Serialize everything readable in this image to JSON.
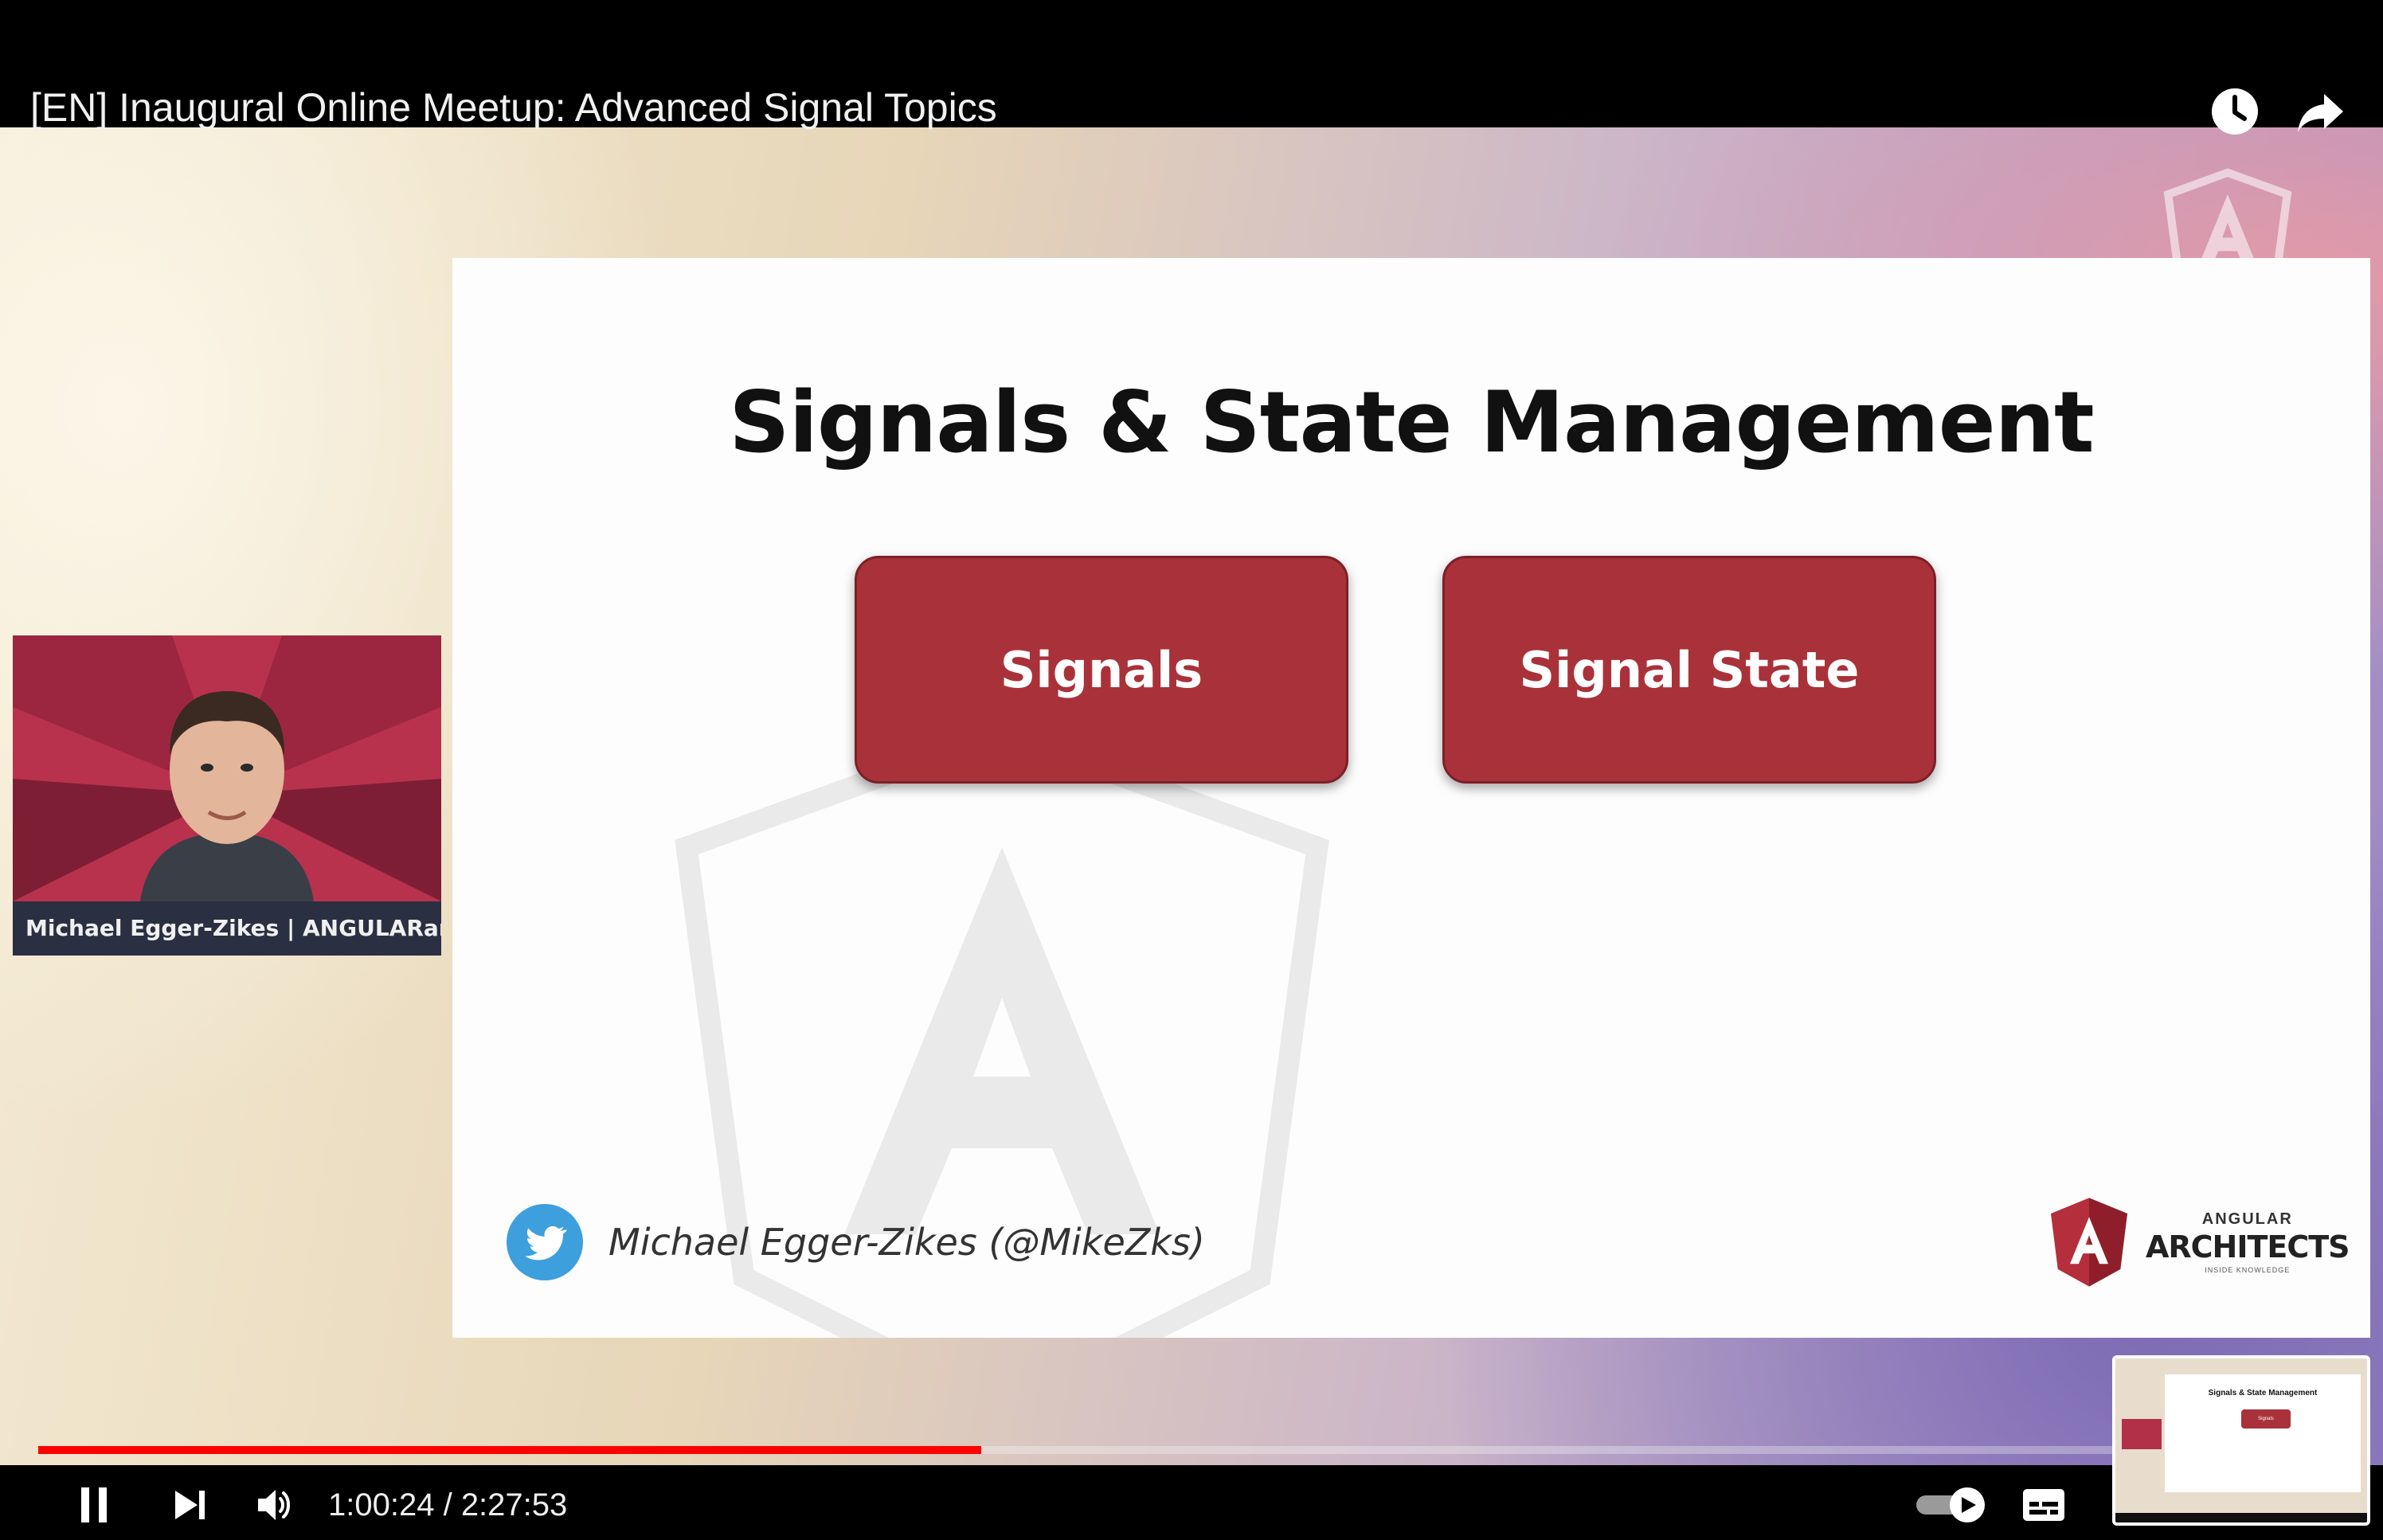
{
  "header": {
    "title": "[EN] Inaugural Online Meetup: Advanced Signal Topics",
    "watch_later_icon": "clock-icon",
    "share_icon": "share-arrow-icon"
  },
  "slide": {
    "title": "Signals & State Management",
    "topics": [
      "Signals",
      "Signal State"
    ],
    "author": "Michael Egger-Zikes (@MikeZks)",
    "brand": {
      "top": "ANGULAR",
      "main": "ARCHITECTS",
      "sub": "INSIDE KNOWLEDGE"
    },
    "accent_color": "#a9323a"
  },
  "webcam": {
    "name": "Michael Egger-Zikes | ANGULARarc..."
  },
  "player": {
    "time_current": "1:00:24",
    "time_separator": " / ",
    "time_total": "2:27:53",
    "progress_percent": 40.9,
    "progress_color": "#ff0000",
    "autoplay_on": true,
    "icons": [
      "pause-icon",
      "next-icon",
      "volume-icon",
      "autoplay-toggle",
      "subtitles-icon"
    ]
  },
  "preview": {
    "title": "Signals & State Management",
    "topic": "Signals"
  }
}
